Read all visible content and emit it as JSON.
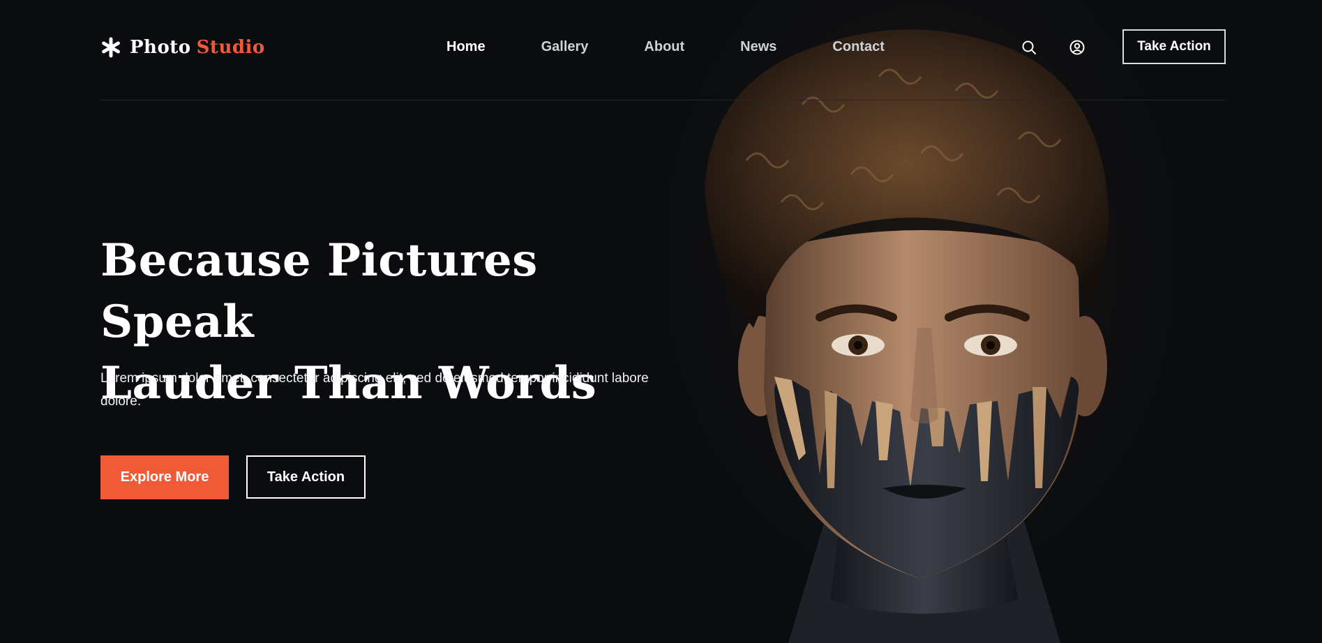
{
  "brand": {
    "icon": "asterisk-icon",
    "name_part1": "Photo",
    "name_part2": "Studio",
    "accent_color": "#f15a37"
  },
  "nav": {
    "items": [
      {
        "label": "Home",
        "active": true
      },
      {
        "label": "Gallery",
        "active": false
      },
      {
        "label": "About",
        "active": false
      },
      {
        "label": "News",
        "active": false
      },
      {
        "label": "Contact",
        "active": false
      }
    ]
  },
  "header": {
    "search_icon": "search-icon",
    "user_icon": "user-circle-icon",
    "cta_label": "Take Action"
  },
  "hero": {
    "title_line1": "Because Pictures Speak",
    "title_line2": "Lauder Than Words",
    "description": "Lorem ipsum dolor amet, consectetur adipiscing elit, sed do eiusmod tempor incididunt labore dolore.",
    "primary_button": "Explore More",
    "secondary_button": "Take Action",
    "image": "portrait-photo"
  },
  "colors": {
    "background": "#0a0c10",
    "accent": "#f15a37",
    "text": "#ffffff"
  }
}
